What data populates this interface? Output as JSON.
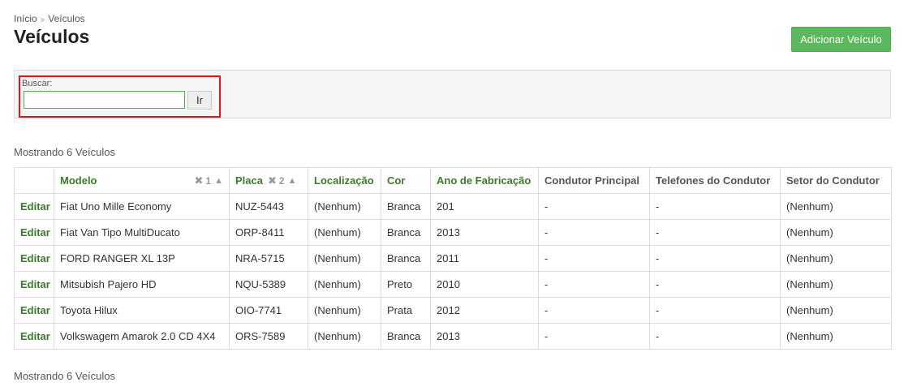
{
  "breadcrumb": {
    "home": "Início",
    "separator": "»",
    "current": "Veículos"
  },
  "page_title": "Veículos",
  "add_button": "Adicionar Veículo",
  "search": {
    "label": "Buscar:",
    "value": "",
    "placeholder": "",
    "button": "Ir"
  },
  "result_count_top": "Mostrando 6 Veículos",
  "result_count_bottom": "Mostrando 6 Veículos",
  "table": {
    "columns": {
      "modelo": "Modelo",
      "placa": "Placa",
      "localizacao": "Localização",
      "cor": "Cor",
      "ano": "Ano de Fabricação",
      "condutor": "Condutor Principal",
      "telefones": "Telefones do Condutor",
      "setor": "Setor do Condutor"
    },
    "sort": {
      "modelo": {
        "remove_icon": "times-icon",
        "priority": "1",
        "direction_icon": "chevron-up-icon"
      },
      "placa": {
        "remove_icon": "times-icon",
        "priority": "2",
        "direction_icon": "chevron-up-icon"
      }
    },
    "edit_label": "Editar",
    "rows": [
      {
        "modelo": "Fiat Uno Mille Economy",
        "placa": "NUZ-5443",
        "localizacao": "(Nenhum)",
        "cor": "Branca",
        "ano": "201",
        "condutor": "-",
        "telefones": "-",
        "setor": "(Nenhum)"
      },
      {
        "modelo": "Fiat Van Tipo MultiDucato",
        "placa": "ORP-8411",
        "localizacao": "(Nenhum)",
        "cor": "Branca",
        "ano": "2013",
        "condutor": "-",
        "telefones": "-",
        "setor": "(Nenhum)"
      },
      {
        "modelo": "FORD RANGER XL 13P",
        "placa": "NRA-5715",
        "localizacao": "(Nenhum)",
        "cor": "Branca",
        "ano": "2011",
        "condutor": "-",
        "telefones": "-",
        "setor": "(Nenhum)"
      },
      {
        "modelo": "Mitsubish Pajero HD",
        "placa": "NQU-5389",
        "localizacao": "(Nenhum)",
        "cor": "Preto",
        "ano": "2010",
        "condutor": "-",
        "telefones": "-",
        "setor": "(Nenhum)"
      },
      {
        "modelo": "Toyota Hilux",
        "placa": "OIO-7741",
        "localizacao": "(Nenhum)",
        "cor": "Prata",
        "ano": "2012",
        "condutor": "-",
        "telefones": "-",
        "setor": "(Nenhum)"
      },
      {
        "modelo": "Volkswagem Amarok 2.0 CD 4X4",
        "placa": "ORS-7589",
        "localizacao": "(Nenhum)",
        "cor": "Branca",
        "ano": "2013",
        "condutor": "-",
        "telefones": "-",
        "setor": "(Nenhum)"
      }
    ]
  },
  "colors": {
    "accent_green": "#5cb85c",
    "link_green": "#3c7a2b",
    "highlight_red": "#e0141a"
  }
}
